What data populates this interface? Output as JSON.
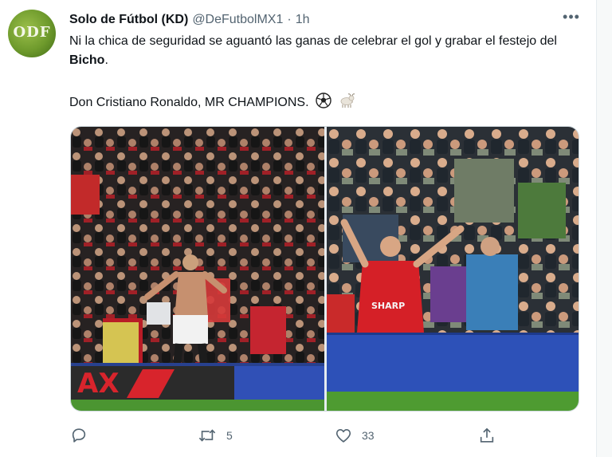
{
  "tweet": {
    "author": {
      "display_name": "Solo de Fútbol (KD)",
      "handle": "@DeFutbolMX1",
      "separator": "·",
      "time": "1h",
      "avatar_text": "ODF"
    },
    "text_line1_pre": "Ni la chica de seguridad se aguantó las ganas de celebrar el gol y grabar el festejo del ",
    "text_line1_bold": "Bicho",
    "text_line1_post": ".",
    "text_line2": "Don Cristiano Ronaldo, MR CHAMPIONS.",
    "emojis": [
      "soccer-ball-emoji",
      "goat-emoji"
    ],
    "media": {
      "photos": [
        "stadium-celebration-photo-left",
        "stadium-celebration-photo-right"
      ]
    },
    "actions": {
      "reply_count": "",
      "retweet_count": "5",
      "like_count": "33",
      "share_count": ""
    }
  },
  "colors": {
    "text": "#0f1419",
    "secondary": "#536471",
    "united_red": "#d51f29",
    "board_blue": "#2a4fb5",
    "pitch_green": "#4d9a33"
  }
}
